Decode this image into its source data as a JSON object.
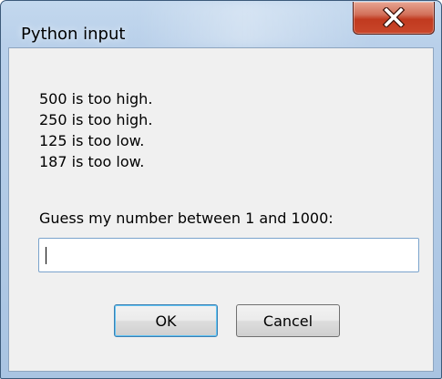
{
  "window": {
    "title": "Python input"
  },
  "messages": [
    "500 is too high.",
    "250 is too high.",
    "125 is too low.",
    "187 is too low."
  ],
  "prompt": "Guess my number between 1 and 1000:",
  "input": {
    "value": "",
    "placeholder": ""
  },
  "buttons": {
    "ok": "OK",
    "cancel": "Cancel"
  },
  "colors": {
    "close_button": "#c9462a",
    "frame": "#a9c4e2",
    "dialog_bg": "#f0f0f0"
  },
  "icons": {
    "close": "close-icon"
  }
}
